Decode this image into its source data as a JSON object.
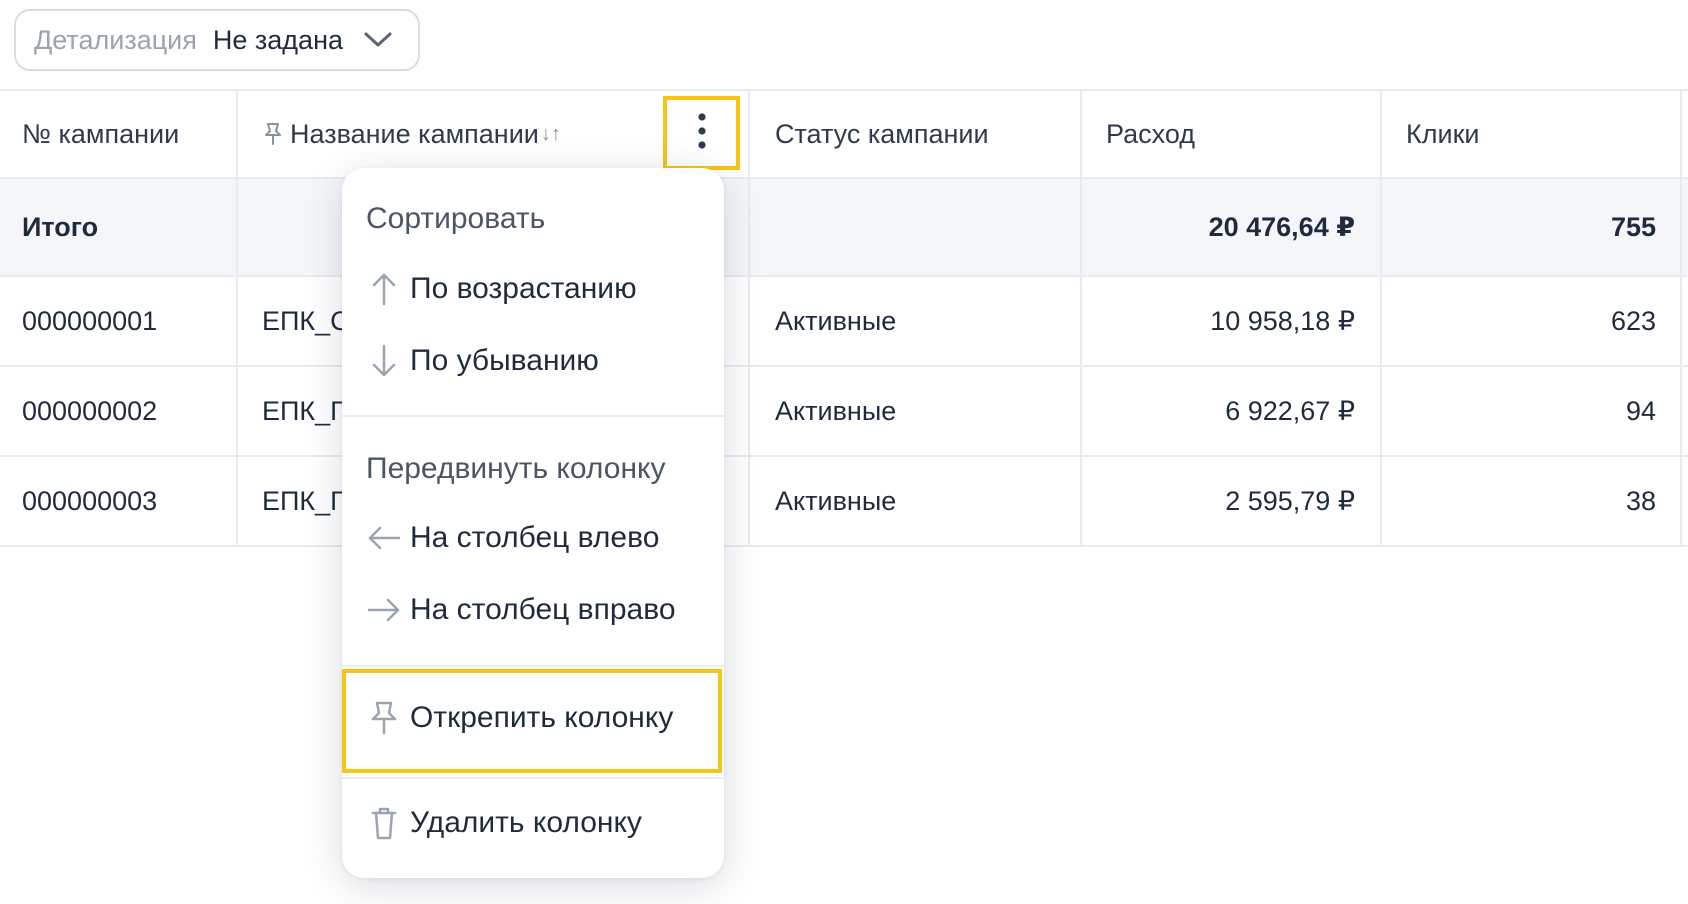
{
  "filter": {
    "label": "Детализация",
    "value": "Не задана",
    "icon": "chevron-down-icon"
  },
  "table": {
    "headers": {
      "campaign_id": "№ кампании",
      "campaign_name": "Название кампании",
      "status": "Статус кампании",
      "spend": "Расход",
      "clicks": "Клики"
    },
    "total": {
      "label": "Итого",
      "spend": "20 476,64 ₽",
      "clicks": "755"
    },
    "rows": [
      {
        "id": "000000001",
        "name": "ЕПК_С",
        "status": "Активные",
        "spend": "10 958,18 ₽",
        "clicks": "623"
      },
      {
        "id": "000000002",
        "name": "ЕПК_Г",
        "status": "Активные",
        "spend": "6 922,67 ₽",
        "clicks": "94"
      },
      {
        "id": "000000003",
        "name": "ЕПК_Г",
        "status": "Активные",
        "spend": "2 595,79 ₽",
        "clicks": "38"
      }
    ]
  },
  "menu": {
    "sort_title": "Сортировать",
    "sort_asc": "По возрастанию",
    "sort_desc": "По убыванию",
    "move_title": "Передвинуть колонку",
    "move_left": "На столбец влево",
    "move_right": "На столбец вправо",
    "unpin": "Открепить колонку",
    "delete": "Удалить колонку"
  },
  "colors": {
    "highlight": "#f5c518",
    "text": "#1f2b3d",
    "muted": "#9aa3b0",
    "total_bg": "#f4f6f9"
  }
}
